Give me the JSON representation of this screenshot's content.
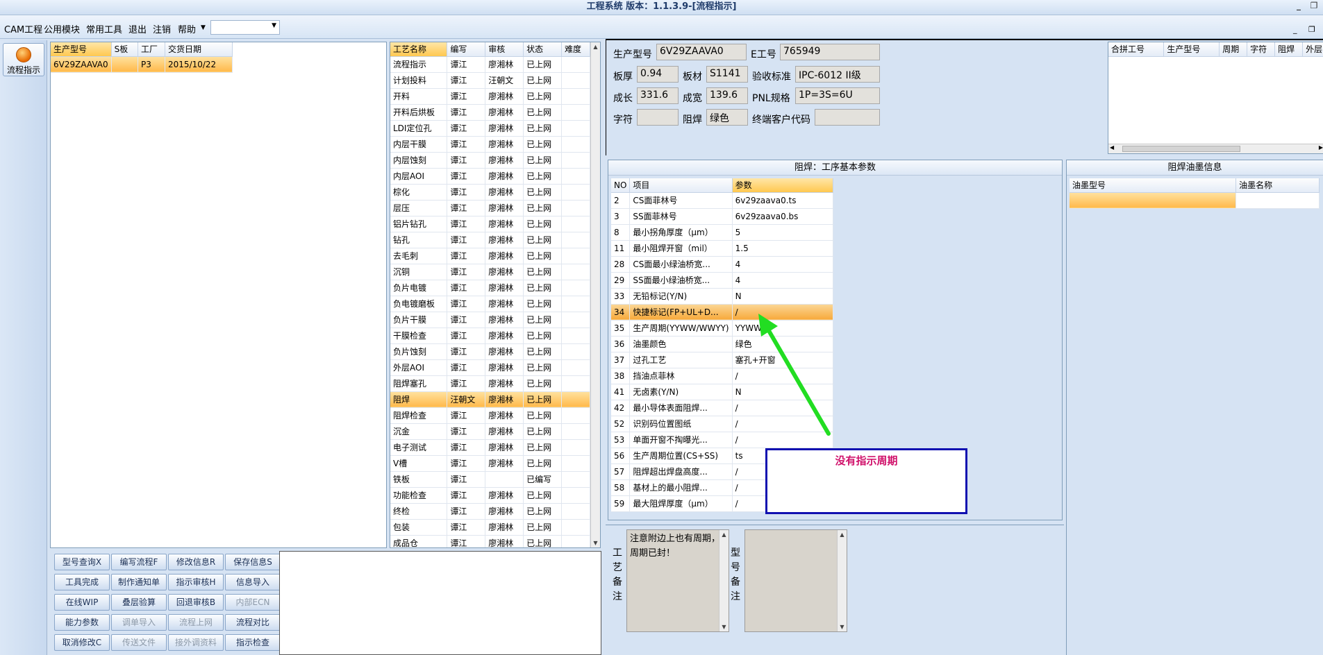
{
  "window": {
    "title": "工程系统 版本：1.1.3.9-[流程指示]"
  },
  "menu": {
    "items": [
      "CAM工程",
      "公用模块",
      "常用工具",
      "退出",
      "注销",
      "帮助"
    ],
    "combo_value": ""
  },
  "sidebar": {
    "flow_button": "流程指示"
  },
  "product_list": {
    "headers": [
      "生产型号",
      "S板",
      "工厂",
      "交货日期"
    ],
    "rows": [
      [
        "6V29ZAAVA0",
        "",
        "P3",
        "2015/10/22"
      ]
    ]
  },
  "process_list": {
    "headers": [
      "工艺名称",
      "编写",
      "审核",
      "状态",
      "难度"
    ],
    "rows": [
      [
        "流程指示",
        "谭江",
        "廖湘林",
        "已上网",
        ""
      ],
      [
        "计划投料",
        "谭江",
        "汪朝文",
        "已上网",
        ""
      ],
      [
        "开料",
        "谭江",
        "廖湘林",
        "已上网",
        ""
      ],
      [
        "开料后烘板",
        "谭江",
        "廖湘林",
        "已上网",
        ""
      ],
      [
        "LDI定位孔",
        "谭江",
        "廖湘林",
        "已上网",
        ""
      ],
      [
        "内层干膜",
        "谭江",
        "廖湘林",
        "已上网",
        ""
      ],
      [
        "内层蚀刻",
        "谭江",
        "廖湘林",
        "已上网",
        ""
      ],
      [
        "内层AOI",
        "谭江",
        "廖湘林",
        "已上网",
        ""
      ],
      [
        "棕化",
        "谭江",
        "廖湘林",
        "已上网",
        ""
      ],
      [
        "层压",
        "谭江",
        "廖湘林",
        "已上网",
        ""
      ],
      [
        "铝片钻孔",
        "谭江",
        "廖湘林",
        "已上网",
        ""
      ],
      [
        "钻孔",
        "谭江",
        "廖湘林",
        "已上网",
        ""
      ],
      [
        "去毛刺",
        "谭江",
        "廖湘林",
        "已上网",
        ""
      ],
      [
        "沉铜",
        "谭江",
        "廖湘林",
        "已上网",
        ""
      ],
      [
        "负片电镀",
        "谭江",
        "廖湘林",
        "已上网",
        ""
      ],
      [
        "负电镀磨板",
        "谭江",
        "廖湘林",
        "已上网",
        ""
      ],
      [
        "负片干膜",
        "谭江",
        "廖湘林",
        "已上网",
        ""
      ],
      [
        "干膜检查",
        "谭江",
        "廖湘林",
        "已上网",
        ""
      ],
      [
        "负片蚀刻",
        "谭江",
        "廖湘林",
        "已上网",
        ""
      ],
      [
        "外层AOI",
        "谭江",
        "廖湘林",
        "已上网",
        ""
      ],
      [
        "阻焊塞孔",
        "谭江",
        "廖湘林",
        "已上网",
        ""
      ],
      [
        "阻焊",
        "汪朝文",
        "廖湘林",
        "已上网",
        ""
      ],
      [
        "阻焊检查",
        "谭江",
        "廖湘林",
        "已上网",
        ""
      ],
      [
        "沉金",
        "谭江",
        "廖湘林",
        "已上网",
        ""
      ],
      [
        "电子测试",
        "谭江",
        "廖湘林",
        "已上网",
        ""
      ],
      [
        "V槽",
        "谭江",
        "廖湘林",
        "已上网",
        ""
      ],
      [
        "铁板",
        "谭江",
        "",
        "已编写",
        ""
      ],
      [
        "功能检查",
        "谭江",
        "廖湘林",
        "已上网",
        ""
      ],
      [
        "终检",
        "谭江",
        "廖湘林",
        "已上网",
        ""
      ],
      [
        "包装",
        "谭江",
        "廖湘林",
        "已上网",
        ""
      ],
      [
        "成品仓",
        "谭江",
        "廖湘林",
        "已上网",
        ""
      ]
    ]
  },
  "buttons": [
    [
      "型号查询X",
      "编写流程F",
      "修改信息R",
      "保存信息S"
    ],
    [
      "工具完成",
      "制作通知单",
      "指示审核H",
      "信息导入"
    ],
    [
      "在线WIP",
      "叠层验算",
      "回退审核B",
      "内部ECN"
    ],
    [
      "能力参数",
      "调单导入",
      "流程上网",
      "流程对比"
    ],
    [
      "取消修改C",
      "传送文件",
      "接外调资料",
      "指示检查"
    ]
  ],
  "disabled_buttons": [
    "内部ECN",
    "调单导入",
    "流程上网",
    "传送文件",
    "接外调资料"
  ],
  "info": {
    "labels": {
      "prod": "生产型号",
      "eno": "E工号",
      "thick": "板厚",
      "material": "板材",
      "std": "验收标准",
      "len": "成长",
      "wid": "成宽",
      "pnl": "PNL规格",
      "char": "字符",
      "mask": "阻焊",
      "cust": "终端客户代码"
    },
    "values": {
      "prod": "6V29ZAAVA0",
      "eno": "765949",
      "thick": "0.94",
      "material": "S1141",
      "std": "IPC-6012 II级",
      "len": "331.6",
      "wid": "139.6",
      "pnl": "1P=3S=6U",
      "char": "",
      "mask": "绿色",
      "cust": ""
    }
  },
  "merge_table": {
    "headers": [
      "合拼工号",
      "生产型号",
      "周期",
      "字符",
      "阻焊",
      "外层"
    ]
  },
  "params": {
    "title": "阻焊：工序基本参数",
    "headers": [
      "NO",
      "项目",
      "参数"
    ],
    "rows": [
      [
        "2",
        "CS面菲林号",
        "6v29zaava0.ts"
      ],
      [
        "3",
        "SS面菲林号",
        "6v29zaava0.bs"
      ],
      [
        "8",
        "最小拐角厚度（μm）",
        "5"
      ],
      [
        "11",
        "最小阻焊开窗（mil）",
        "1.5"
      ],
      [
        "28",
        "CS面最小绿油桥宽...",
        "4"
      ],
      [
        "29",
        "SS面最小绿油桥宽...",
        "4"
      ],
      [
        "33",
        "无铅标记(Y/N)",
        "N"
      ],
      [
        "34",
        "快捷标记(FP+UL+D...",
        "/"
      ],
      [
        "35",
        "生产周期(YYWW/WWYY)",
        "YYWW"
      ],
      [
        "36",
        "油墨颜色",
        "绿色"
      ],
      [
        "37",
        "过孔工艺",
        "塞孔+开窗"
      ],
      [
        "38",
        "挡油点菲林",
        "/"
      ],
      [
        "41",
        "无卤素(Y/N)",
        "N"
      ],
      [
        "42",
        "最小导体表面阻焊...",
        "/"
      ],
      [
        "52",
        "识别码位置图纸",
        "/"
      ],
      [
        "53",
        "单面开窗不掏曝光...",
        "/"
      ],
      [
        "56",
        "生产周期位置(CS+SS)",
        "ts"
      ],
      [
        "57",
        "阻焊超出焊盘高度...",
        "/"
      ],
      [
        "58",
        "基材上的最小阻焊...",
        "/"
      ],
      [
        "59",
        "最大阻焊厚度（μm）",
        "/"
      ]
    ]
  },
  "ink": {
    "title": "阻焊油墨信息",
    "headers": [
      "油墨型号",
      "油墨名称"
    ]
  },
  "annotation": {
    "text": "没有指示周期",
    "arrow_color": "#22dd22",
    "box_color": "#1010b0",
    "text_color": "#d0106a"
  },
  "remarks": {
    "process_label": "工艺备注",
    "process_text": "注意附边上也有周期，周期已封！",
    "model_label": "型号备注",
    "model_text": ""
  }
}
